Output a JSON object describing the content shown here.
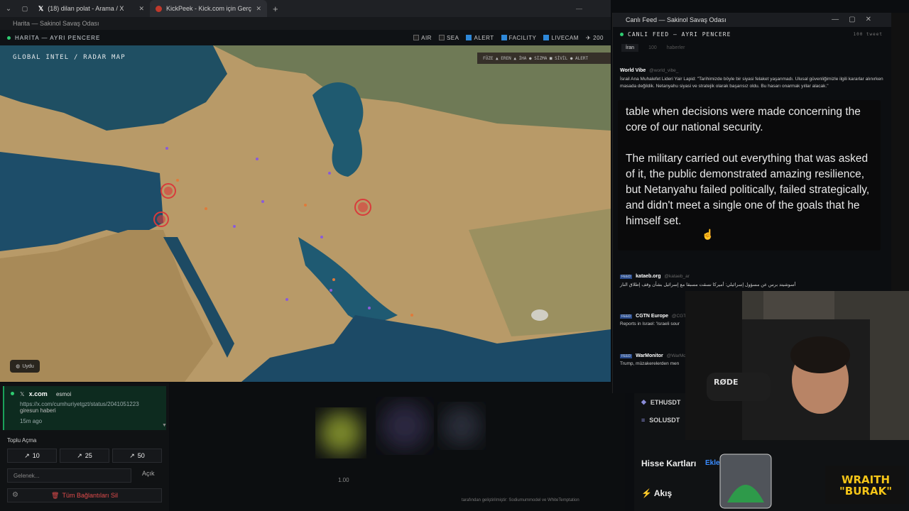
{
  "browser": {
    "tabs": [
      {
        "label": "(18) dilan polat - Arama / X",
        "icon": "x-logo-icon"
      },
      {
        "label": "KickPeek - Kick.com için Gerçek Za",
        "icon": "kickpeek-icon"
      }
    ],
    "window_title": "Harita — Sakinol Savaş Odası"
  },
  "map_window": {
    "header": "HARİTA — AYRI PENCERE",
    "layers": [
      {
        "label": "AIR",
        "checked": false
      },
      {
        "label": "SEA",
        "checked": false
      },
      {
        "label": "ALERT",
        "checked": true
      },
      {
        "label": "FACILITY",
        "checked": true
      },
      {
        "label": "LIVECAM",
        "checked": true
      }
    ],
    "zoom_value": "200",
    "map_title": "GLOBAL INTEL / RADAR MAP",
    "legend": "FÜZE ▲ EREN ▲ İHA ● SİZMA ■ SİVİL ● ALERT",
    "base_layer_button": "Uydu"
  },
  "link_card": {
    "site": "x.com",
    "user": "esmoi",
    "url": "https://x.com/cumhuriyetgzt/status/2041051223",
    "title": "giresun haberi",
    "time": "15m ago"
  },
  "bulk_open": {
    "label": "Toplu Açma",
    "buttons": [
      "10",
      "25",
      "50"
    ],
    "input_placeholder": "Gelenek...",
    "open_label": "Açık",
    "delete_all_label": "Tüm Bağlantıları Sil"
  },
  "center_panel": {
    "value": "1.00",
    "credit": "tarafından geliştirilmiştir: Sodiumummodel ve WhiteTemptation"
  },
  "feed_window": {
    "window_title": "Canlı Feed — Sakinol Savaş Odası",
    "header": "CANLI FEED — AYRI PENCERE",
    "count": "100 tweet",
    "tabs": [
      "İran",
      "100",
      "haberler"
    ],
    "items": [
      {
        "name": "World Vibe",
        "handle": "@world_vibe_",
        "text": "İsrail Ana Muhalefet Lideri Yair Lapid: \"Tarihimizde böyle bir siyasi felaket yaşanmadı. Ulusal güvenliğimizle ilgili kararlar alınırken masada değildik. Netanyahu siyasi ve stratejik olarak başarısız oldu. Bu hasarı onarmak yıllar alacak.\""
      },
      {
        "name": "kataeb.org",
        "handle": "@kataeb_ar",
        "text": "أسوشيتد برس عن مسؤول إسرائيلي: أميركا نسقت مسبقا مع إسرائيل بشأن وقف إطلاق النار",
        "tag": "FEED"
      },
      {
        "name": "CGTN Europe",
        "handle": "@CGTN",
        "text": "Reports in Israel: 'Israeli sour",
        "tag": "FEED"
      },
      {
        "name": "WarMonitor",
        "handle": "@WarMon",
        "text": "Trump, müzakerelerden men",
        "tag": "FEED"
      }
    ],
    "zoom_text": [
      "table when decisions were made concerning the core of our national security.",
      "The military carried out everything that was asked of it, the public demonstrated amazing resilience, but Netanyahu failed politically, failed strategically, and didn't meet a single one of the goals that he himself set."
    ]
  },
  "tickers": {
    "items": [
      "ETHUSDT",
      "SOLUSDT"
    ],
    "stock_cards_label": "Hisse Kartları",
    "add_label": "Ekle",
    "flow_label": "Akış"
  },
  "overlay": {
    "streamer_badge_line1": "WRAITH",
    "streamer_badge_line2": "\"BURAK\"",
    "mic_brand": "RØDE"
  }
}
